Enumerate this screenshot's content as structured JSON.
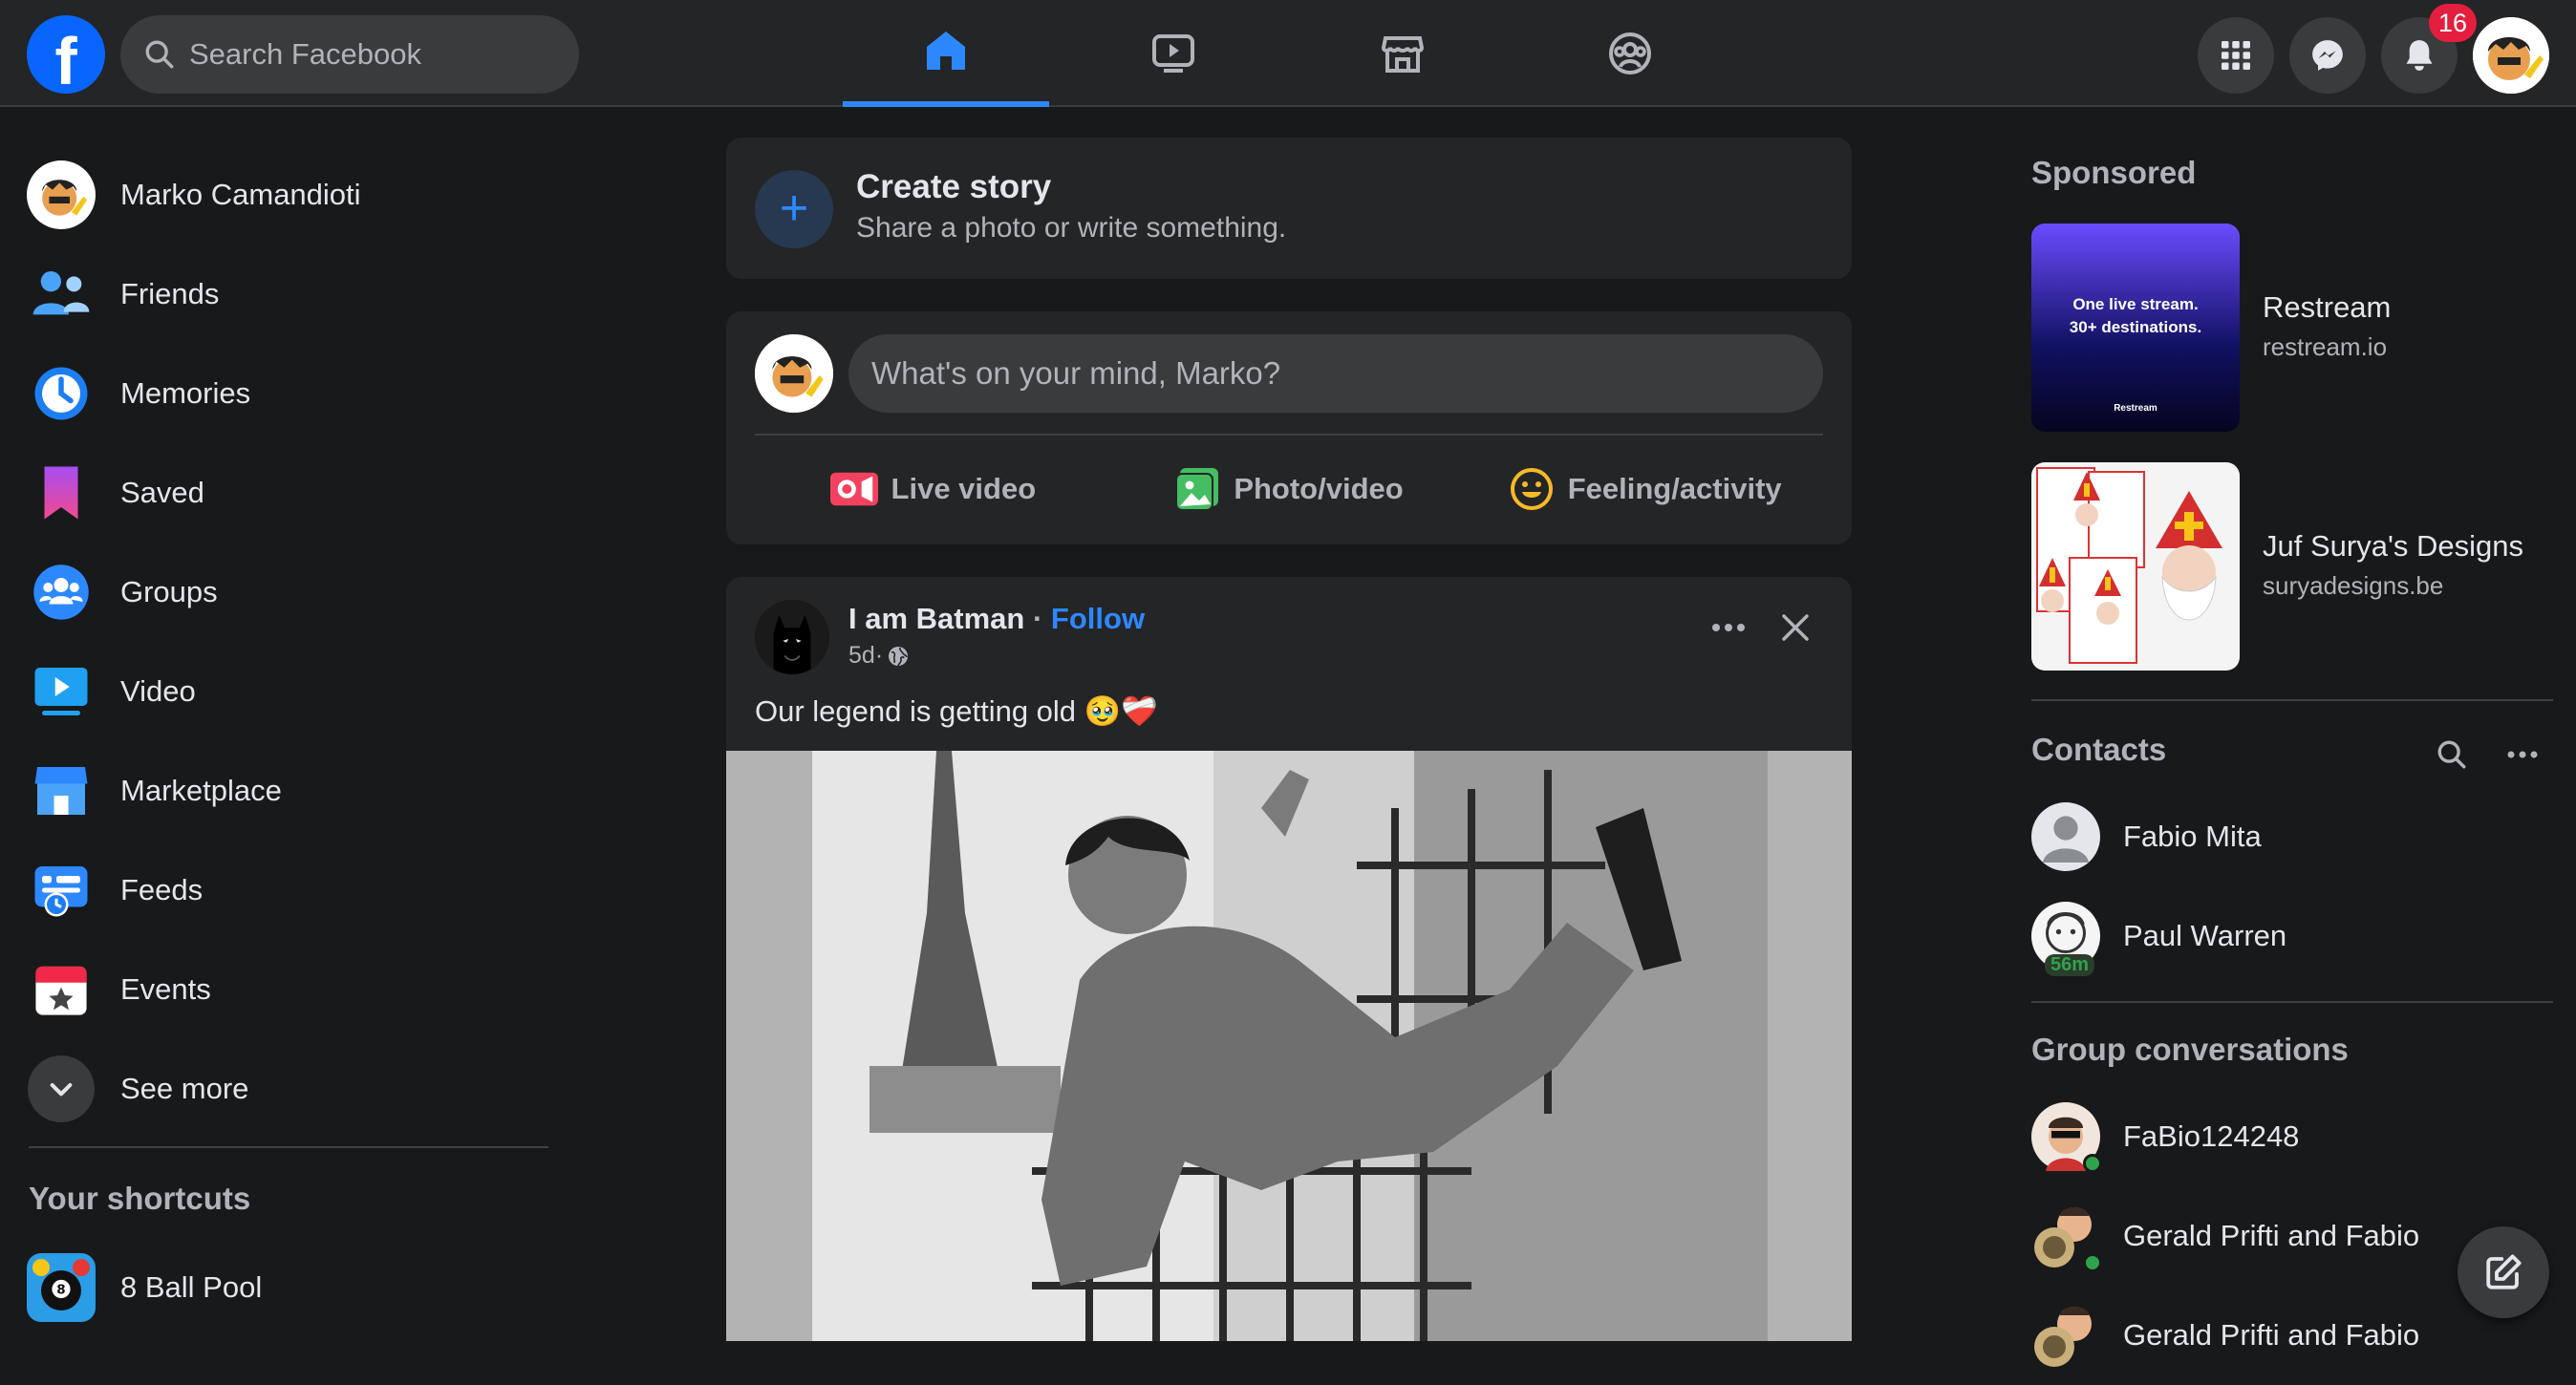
{
  "topbar": {
    "logo_letter": "f",
    "search_placeholder": "Search Facebook",
    "notifications_count": "16"
  },
  "sidebar": {
    "profile_name": "Marko Camandioti",
    "items": [
      {
        "label": "Friends",
        "icon": "friends-icon"
      },
      {
        "label": "Memories",
        "icon": "memories-icon"
      },
      {
        "label": "Saved",
        "icon": "saved-icon"
      },
      {
        "label": "Groups",
        "icon": "groups-icon"
      },
      {
        "label": "Video",
        "icon": "video-icon"
      },
      {
        "label": "Marketplace",
        "icon": "marketplace-icon"
      },
      {
        "label": "Feeds",
        "icon": "feeds-icon"
      },
      {
        "label": "Events",
        "icon": "events-icon"
      },
      {
        "label": "See more",
        "icon": "chevron-down-icon"
      }
    ],
    "shortcuts_title": "Your shortcuts",
    "shortcuts": [
      {
        "label": "8 Ball Pool"
      }
    ]
  },
  "feed": {
    "create_story": {
      "title": "Create story",
      "subtitle": "Share a photo or write something.",
      "plus": "+"
    },
    "composer": {
      "placeholder": "What's on your mind, Marko?",
      "actions": [
        {
          "label": "Live video",
          "icon": "live-video-icon",
          "color": "#f3425f"
        },
        {
          "label": "Photo/video",
          "icon": "photo-icon",
          "color": "#45bd62"
        },
        {
          "label": "Feeling/activity",
          "icon": "feeling-icon",
          "color": "#f7b928"
        }
      ]
    },
    "post": {
      "author": "I am Batman",
      "separator": " · ",
      "follow": "Follow",
      "time": "5d",
      "dot": " · ",
      "text": "Our legend is getting old 🥹❤️‍🩹"
    }
  },
  "right": {
    "sponsored_title": "Sponsored",
    "ads": [
      {
        "name": "Restream",
        "domain": "restream.io",
        "image_text": "One live stream. 30+ destinations.",
        "image_brand": "Restream"
      },
      {
        "name": "Juf Surya's Designs",
        "domain": "suryadesigns.be"
      }
    ],
    "contacts_title": "Contacts",
    "contacts": [
      {
        "name": "Fabio Mita"
      },
      {
        "name": "Paul Warren",
        "time": "56m"
      }
    ],
    "groups_title": "Group conversations",
    "groups": [
      {
        "name": "FaBio124248"
      },
      {
        "name": "Gerald Prifti and Fabio"
      },
      {
        "name": "Gerald Prifti and Fabio"
      }
    ]
  },
  "colors": {
    "accent": "#2d88ff",
    "background": "#18191a",
    "surface": "#242526",
    "badge": "#e41e3f"
  }
}
